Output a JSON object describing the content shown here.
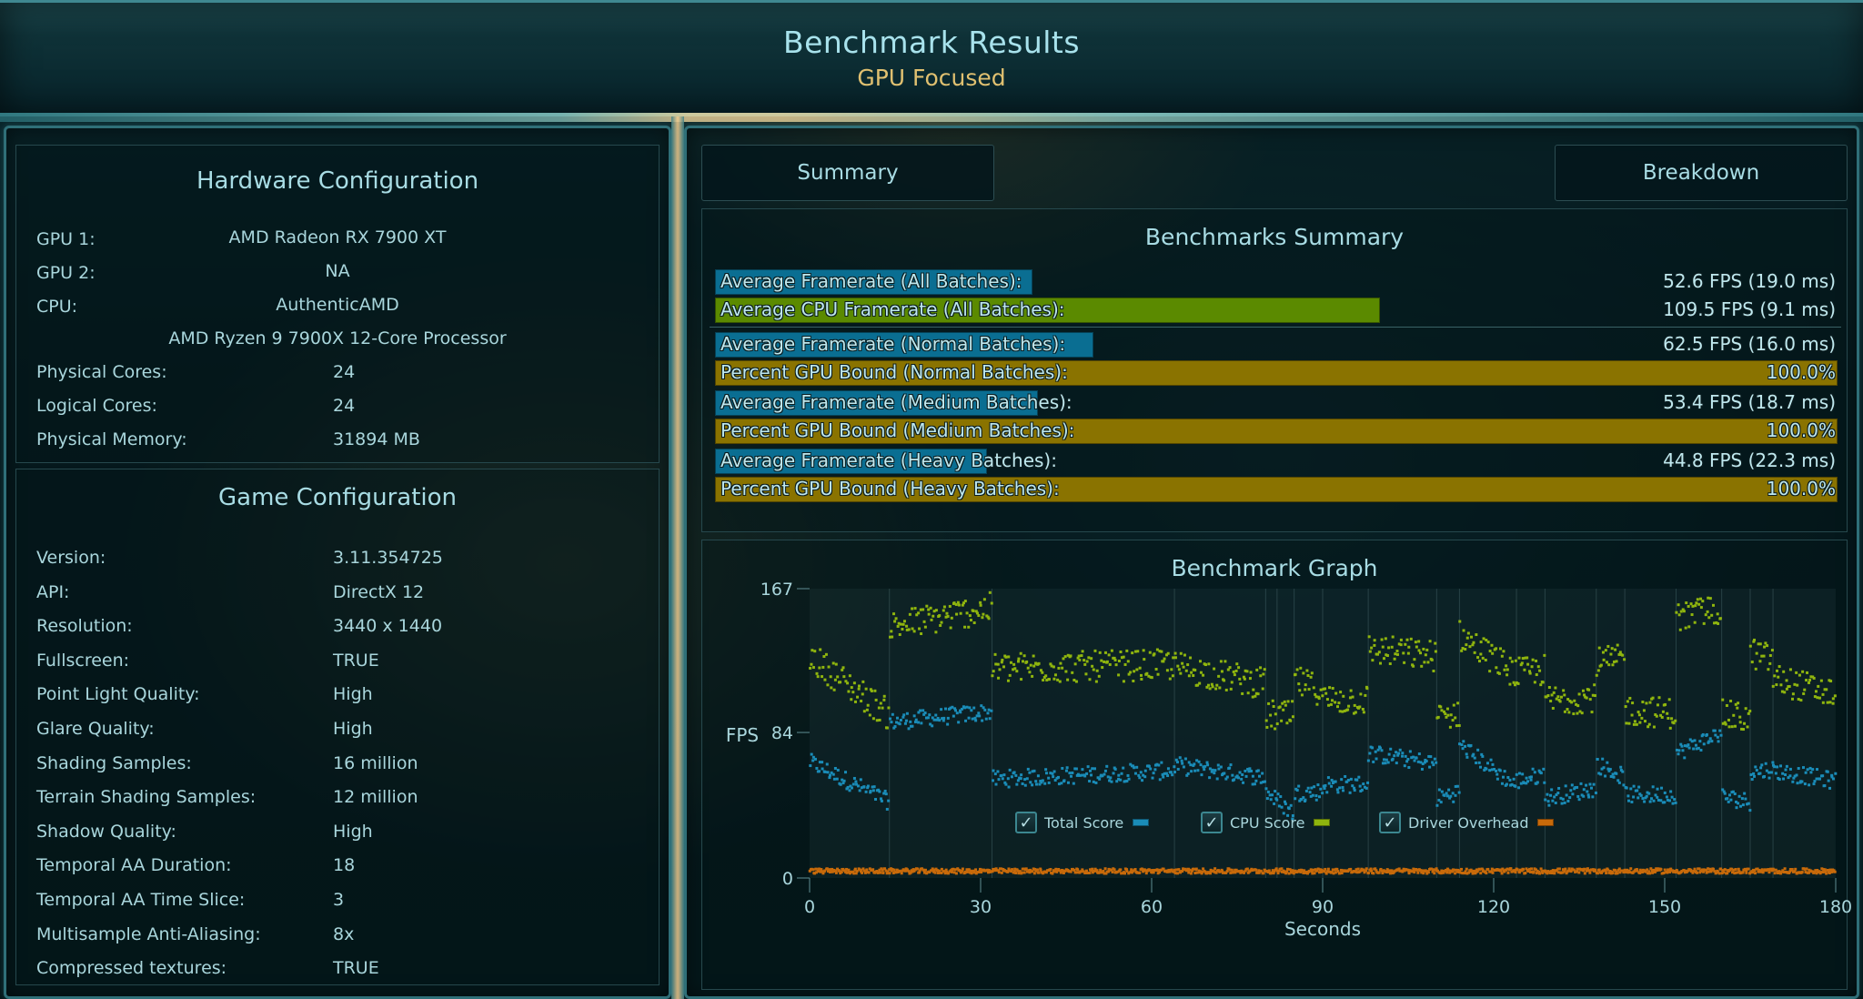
{
  "header": {
    "title": "Benchmark Results",
    "subtitle": "GPU Focused"
  },
  "hardware": {
    "title": "Hardware Configuration",
    "gpu1_label": "GPU 1:",
    "gpu1_value": "AMD Radeon RX 7900 XT",
    "gpu2_label": "GPU 2:",
    "gpu2_value": "NA",
    "cpu_label": "CPU:",
    "cpu_vendor": "AuthenticAMD",
    "cpu_model": "AMD Ryzen 9 7900X 12-Core Processor",
    "items": [
      {
        "label": "Physical Cores:",
        "value": "24"
      },
      {
        "label": "Logical Cores:",
        "value": "24"
      },
      {
        "label": "Physical Memory:",
        "value": "31894  MB"
      }
    ]
  },
  "game": {
    "title": "Game Configuration",
    "items": [
      {
        "label": "Version:",
        "value": "3.11.354725"
      },
      {
        "label": "API:",
        "value": "DirectX 12"
      },
      {
        "label": "Resolution:",
        "value": "3440 x 1440"
      },
      {
        "label": "Fullscreen:",
        "value": "TRUE"
      },
      {
        "label": "Point Light Quality:",
        "value": "High"
      },
      {
        "label": "Glare Quality:",
        "value": "High"
      },
      {
        "label": "Shading Samples:",
        "value": "16 million"
      },
      {
        "label": "Terrain Shading Samples:",
        "value": "12 million"
      },
      {
        "label": "Shadow Quality:",
        "value": "High"
      },
      {
        "label": "Temporal AA Duration:",
        "value": "18"
      },
      {
        "label": "Temporal AA Time Slice:",
        "value": "3"
      },
      {
        "label": "Multisample Anti-Aliasing:",
        "value": "8x"
      },
      {
        "label": "Compressed textures:",
        "value": "TRUE"
      }
    ]
  },
  "tabs": {
    "summary": "Summary",
    "breakdown": "Breakdown"
  },
  "summary": {
    "title": "Benchmarks Summary",
    "colors": {
      "total": "#0a6e92",
      "cpu": "#5b8a00",
      "gpu_bound": "#8a7300"
    },
    "rows": [
      {
        "label": "Average Framerate (All Batches):",
        "value": "52.6 FPS (19.0 ms)",
        "kind": "total",
        "fill": 0.283
      },
      {
        "label": "Average CPU Framerate (All Batches):",
        "value": "109.5 FPS (9.1 ms)",
        "kind": "cpu",
        "fill": 0.592
      },
      {
        "label": "Average Framerate (Normal Batches):",
        "value": "62.5 FPS (16.0 ms)",
        "kind": "total",
        "fill": 0.337
      },
      {
        "label": "Percent GPU Bound (Normal Batches):",
        "value": "100.0%",
        "kind": "gpu_bound",
        "fill": 1.0
      },
      {
        "label": "Average Framerate (Medium Batches):",
        "value": "53.4 FPS (18.7 ms)",
        "kind": "total",
        "fill": 0.288
      },
      {
        "label": "Percent GPU Bound (Medium Batches):",
        "value": "100.0%",
        "kind": "gpu_bound",
        "fill": 1.0
      },
      {
        "label": "Average Framerate (Heavy Batches):",
        "value": "44.8 FPS (22.3 ms)",
        "kind": "total",
        "fill": 0.242
      },
      {
        "label": "Percent GPU Bound (Heavy Batches):",
        "value": "100.0%",
        "kind": "gpu_bound",
        "fill": 1.0
      }
    ]
  },
  "chart_data": {
    "type": "scatter",
    "title": "Benchmark Graph",
    "xlabel": "Seconds",
    "ylabel": "FPS",
    "xlim": [
      0,
      180
    ],
    "ylim": [
      0,
      167
    ],
    "xticks": [
      0,
      30,
      60,
      90,
      120,
      150,
      180
    ],
    "yticks": [
      0,
      84,
      167
    ],
    "grid": "vertical batch separators",
    "legend_placement": "bottom-center",
    "batch_boundaries": [
      14,
      32,
      64,
      80,
      82,
      85,
      90,
      98,
      110,
      114,
      124,
      129,
      138,
      143,
      152,
      160,
      165,
      169
    ],
    "series": [
      {
        "name": "Total Score",
        "color": "#1a8cb8",
        "checked": true,
        "segments": [
          {
            "x": [
              0,
              14
            ],
            "y": [
              67,
              44
            ]
          },
          {
            "x": [
              14,
              32
            ],
            "y": [
              90,
              96
            ]
          },
          {
            "x": [
              32,
              64
            ],
            "y": [
              57,
              62
            ]
          },
          {
            "x": [
              64,
              80
            ],
            "y": [
              65,
              58
            ]
          },
          {
            "x": [
              80,
              85
            ],
            "y": [
              50,
              37
            ]
          },
          {
            "x": [
              85,
              90
            ],
            "y": [
              49,
              50
            ]
          },
          {
            "x": [
              90,
              98
            ],
            "y": [
              54,
              54
            ]
          },
          {
            "x": [
              98,
              110
            ],
            "y": [
              72,
              66
            ]
          },
          {
            "x": [
              110,
              114
            ],
            "y": [
              46,
              50
            ]
          },
          {
            "x": [
              114,
              124
            ],
            "y": [
              77,
              53
            ]
          },
          {
            "x": [
              124,
              129
            ],
            "y": [
              56,
              60
            ]
          },
          {
            "x": [
              129,
              138
            ],
            "y": [
              46,
              52
            ]
          },
          {
            "x": [
              138,
              143
            ],
            "y": [
              66,
              58
            ]
          },
          {
            "x": [
              143,
              152
            ],
            "y": [
              48,
              48
            ]
          },
          {
            "x": [
              152,
              160
            ],
            "y": [
              72,
              84
            ]
          },
          {
            "x": [
              160,
              165
            ],
            "y": [
              47,
              44
            ]
          },
          {
            "x": [
              165,
              169
            ],
            "y": [
              61,
              63
            ]
          },
          {
            "x": [
              169,
              180
            ],
            "y": [
              62,
              56
            ]
          }
        ]
      },
      {
        "name": "CPU Score",
        "color": "#8fb50e",
        "checked": true,
        "segments": [
          {
            "x": [
              0,
              14
            ],
            "y": [
              128,
              94
            ]
          },
          {
            "x": [
              14,
              32
            ],
            "y": [
              145,
              156
            ]
          },
          {
            "x": [
              32,
              64
            ],
            "y": [
              121,
              123
            ]
          },
          {
            "x": [
              64,
              80
            ],
            "y": [
              122,
              112
            ]
          },
          {
            "x": [
              80,
              85
            ],
            "y": [
              94,
              93
            ]
          },
          {
            "x": [
              85,
              90
            ],
            "y": [
              114,
              108
            ]
          },
          {
            "x": [
              90,
              98
            ],
            "y": [
              103,
              103
            ]
          },
          {
            "x": [
              98,
              110
            ],
            "y": [
              132,
              128
            ]
          },
          {
            "x": [
              110,
              114
            ],
            "y": [
              92,
              96
            ]
          },
          {
            "x": [
              114,
              124
            ],
            "y": [
              140,
              118
            ]
          },
          {
            "x": [
              124,
              129
            ],
            "y": [
              118,
              120
            ]
          },
          {
            "x": [
              129,
              138
            ],
            "y": [
              102,
              105
            ]
          },
          {
            "x": [
              138,
              143
            ],
            "y": [
              124,
              126
            ]
          },
          {
            "x": [
              143,
              152
            ],
            "y": [
              97,
              95
            ]
          },
          {
            "x": [
              152,
              160
            ],
            "y": [
              150,
              156
            ]
          },
          {
            "x": [
              160,
              165
            ],
            "y": [
              94,
              92
            ]
          },
          {
            "x": [
              165,
              169
            ],
            "y": [
              130,
              126
            ]
          },
          {
            "x": [
              169,
              180
            ],
            "y": [
              115,
              106
            ]
          }
        ]
      },
      {
        "name": "Driver Overhead",
        "color": "#c86a0a",
        "checked": true,
        "segments": [
          {
            "x": [
              0,
              180
            ],
            "y": [
              4,
              4
            ]
          }
        ]
      }
    ]
  }
}
